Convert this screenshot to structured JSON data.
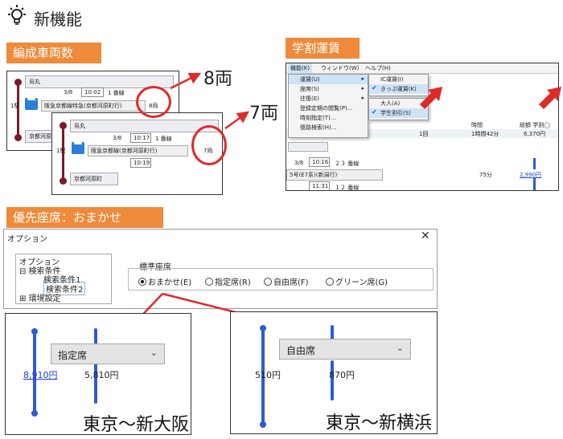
{
  "header": {
    "title": "新機能"
  },
  "colors": {
    "accent_orange": "#ee8a3a",
    "red": "#e02a2a",
    "blue": "#2d5bd4",
    "maroon": "#7a1a2a"
  },
  "sections": {
    "cars": "編成車両数",
    "student_fare": "学割運賃",
    "priority_seat": "優先座席：おまかせ"
  },
  "cars": {
    "back": {
      "from": "烏丸",
      "date": "3/8",
      "time": "10:02",
      "track": "1 番線",
      "change": "1駅",
      "route": "阪急京都線特急(京都河原町行)",
      "cars": "8両",
      "to": "京都河原町"
    },
    "front": {
      "from": "烏丸",
      "date": "3/8",
      "time": "10:17",
      "track": "1 番線",
      "change": "1駅",
      "route": "阪急京都線(京都河原町行)",
      "cars": "7両",
      "arr_time": "10:19",
      "to": "京都河原町"
    },
    "callout_back": "8両",
    "callout_front": "7両"
  },
  "fare": {
    "menubar": [
      "機能(K)",
      "ウィンドウ(W)",
      "ヘルプ(H)"
    ],
    "menu1": [
      "運賃(U)",
      "座席(S)",
      "往復(E)",
      "登録定期の閲覧(P)...",
      "時刻指定(T)...",
      "復路検索(H)..."
    ],
    "menu2": [
      "IC運賃(I)",
      "きっぷ運賃(K)"
    ],
    "menu3": [
      "大人(A)",
      "学生割引(S)"
    ],
    "col_time": "時間",
    "col_total": "総額 学割◯",
    "row_count": "1回",
    "row_duration": "1時間42分",
    "row_fare": "6,370円",
    "date": "3/8",
    "time1": "10:16",
    "track1": "２３ 番線",
    "train": "5号(E7系)(新潟行)",
    "min": "75分",
    "link_fare": "2,990円",
    "time2": "11:31",
    "track2": "１２ 番線"
  },
  "options": {
    "title": "オプション",
    "tree": [
      "オプション",
      "検索条件",
      "検索条件1",
      "検索条件2",
      "環境設定"
    ],
    "group_label": "標準座席",
    "radios": [
      "おまかせ(E)",
      "指定席(R)",
      "自由席(F)",
      "グリーン席(G)"
    ],
    "selected": 0
  },
  "examples": {
    "left": {
      "seat": "指定席",
      "price1": "8,910円",
      "price2": "5,810円",
      "caption": "東京～新大阪"
    },
    "right": {
      "seat": "自由席",
      "price1": "510円",
      "price2": "870円",
      "caption": "東京～新横浜"
    }
  }
}
